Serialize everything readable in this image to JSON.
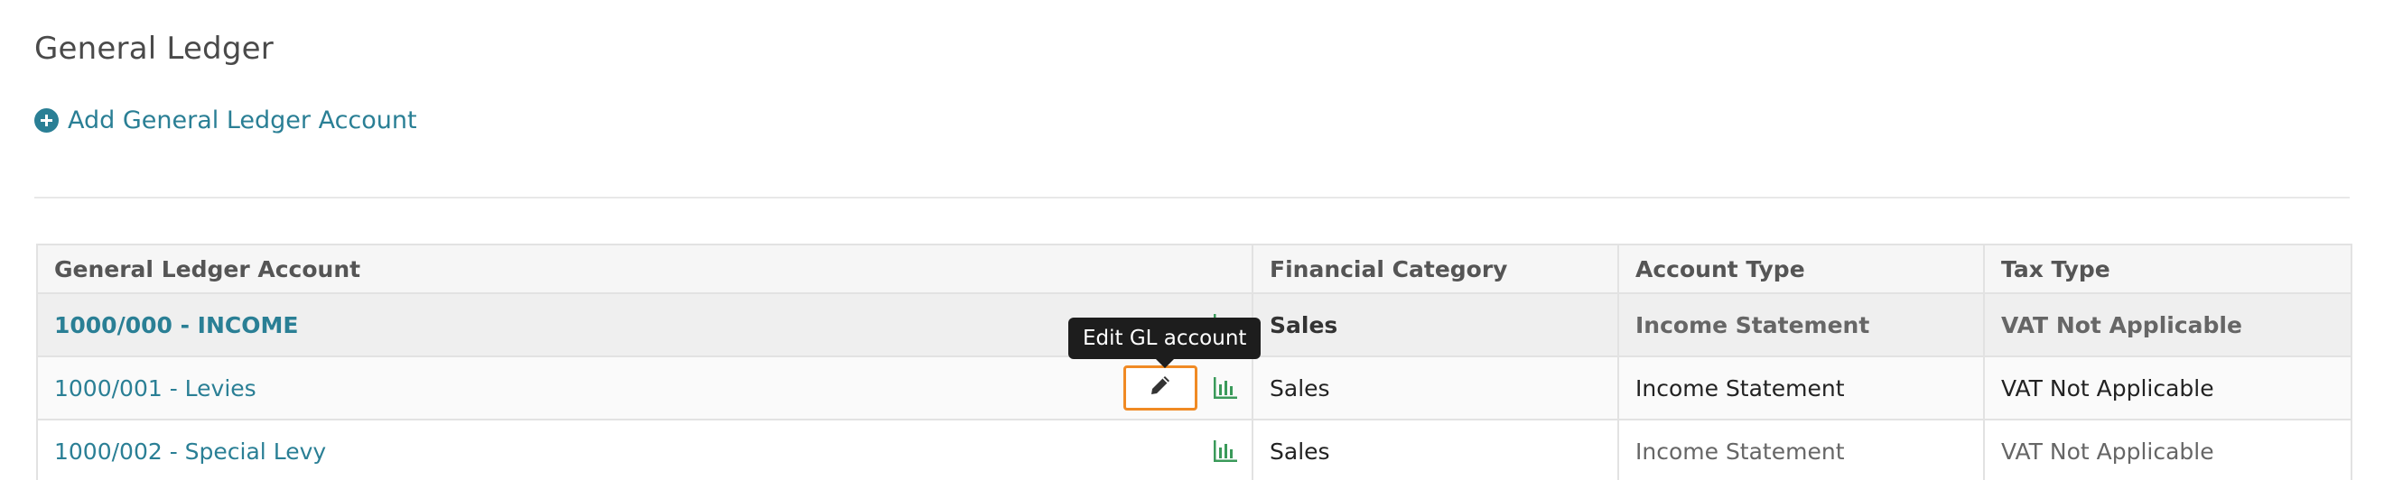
{
  "page": {
    "title": "General Ledger",
    "add_link_label": "Add General Ledger Account"
  },
  "colors": {
    "link": "#2a7f95",
    "chart_icon": "#3a9a5a",
    "focus_outline": "#f08a24",
    "tooltip_bg": "#1d1d1d"
  },
  "table": {
    "headers": {
      "account": "General Ledger Account",
      "category": "Financial Category",
      "type": "Account Type",
      "tax": "Tax Type"
    },
    "rows": [
      {
        "account": "1000/000 - INCOME",
        "category": "Sales",
        "type": "Income Statement",
        "tax": "VAT Not Applicable"
      },
      {
        "account": "1000/001 - Levies",
        "category": "Sales",
        "type": "Income Statement",
        "tax": "VAT Not Applicable"
      },
      {
        "account": "1000/002 - Special Levy",
        "category": "Sales",
        "type": "Income Statement",
        "tax": "VAT Not Applicable"
      }
    ]
  },
  "tooltip": {
    "text": "Edit GL account"
  },
  "icons": {
    "add": "plus-circle-icon",
    "chart": "bar-chart-icon",
    "edit": "pencil-icon"
  }
}
